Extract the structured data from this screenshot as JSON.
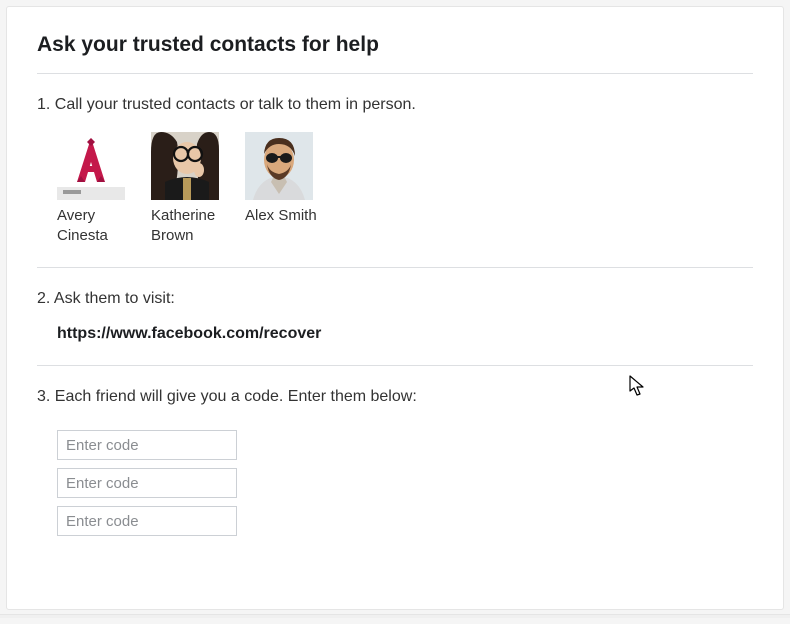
{
  "title": "Ask your trusted contacts for help",
  "steps": {
    "s1": {
      "text": "1. Call your trusted contacts or talk to them in person."
    },
    "s2": {
      "text": "2. Ask them to visit:",
      "url": "https://www.facebook.com/recover"
    },
    "s3": {
      "text": "3. Each friend will give you a code. Enter them below:"
    }
  },
  "contacts": [
    {
      "name": "Avery Cinesta"
    },
    {
      "name": "Katherine Brown"
    },
    {
      "name": "Alex Smith"
    }
  ],
  "code_inputs": [
    {
      "placeholder": "Enter code"
    },
    {
      "placeholder": "Enter code"
    },
    {
      "placeholder": "Enter code"
    }
  ]
}
